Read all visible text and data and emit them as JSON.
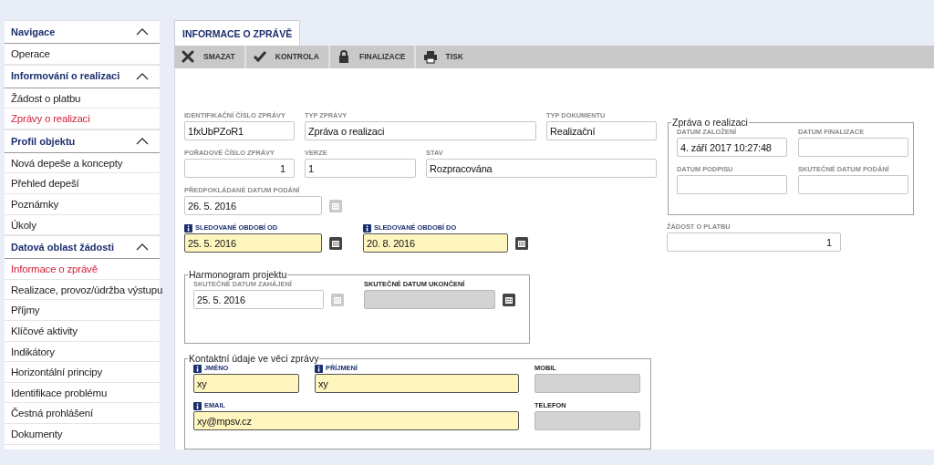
{
  "sidebar": {
    "sections": [
      {
        "title": "Navigace",
        "expanded": true,
        "items": [
          {
            "label": "Operace",
            "selected": false
          }
        ]
      },
      {
        "title": "Informování o realizaci",
        "expanded": true,
        "items": [
          {
            "label": "Žádost o platbu",
            "selected": false
          },
          {
            "label": "Zprávy o realizaci",
            "selected": true
          }
        ]
      },
      {
        "title": "Profil objektu",
        "expanded": true,
        "items": [
          {
            "label": "Nová depeše a koncepty",
            "selected": false
          },
          {
            "label": "Přehled depeší",
            "selected": false
          },
          {
            "label": "Poznámky",
            "selected": false
          },
          {
            "label": "Úkoly",
            "selected": false
          }
        ]
      },
      {
        "title": "Datová oblast žádosti",
        "expanded": true,
        "items": [
          {
            "label": "Informace o zprávě",
            "selected": true
          },
          {
            "label": "Realizace, provoz/údržba výstupu",
            "selected": false
          },
          {
            "label": "Příjmy",
            "selected": false
          },
          {
            "label": "Klíčové aktivity",
            "selected": false
          },
          {
            "label": "Indikátory",
            "selected": false
          },
          {
            "label": "Horizontální principy",
            "selected": false
          },
          {
            "label": "Identifikace problému",
            "selected": false
          },
          {
            "label": "Čestná prohlášení",
            "selected": false
          },
          {
            "label": "Dokumenty",
            "selected": false
          }
        ]
      }
    ]
  },
  "tabs": [
    {
      "label": "INFORMACE O ZPRÁVĚ",
      "selected": true
    }
  ],
  "toolbar": [
    "SMAZAT",
    "KONTROLA",
    "FINALIZACE",
    "TISK"
  ],
  "form": {
    "fields": [
      {
        "label": "IDENTIFIKAČNÍ ČÍSLO ZPRÁVY",
        "value": "1fxUbPZoR1",
        "kind": "readonly"
      },
      {
        "label": "TYP ZPRÁVY",
        "value": "Zpráva o realizaci",
        "kind": "readonly"
      },
      {
        "label": "TYP DOKUMENTU",
        "value": "Realizační",
        "kind": "readonly"
      },
      {
        "label": "POŘADOVÉ ČÍSLO ZPRÁVY",
        "value": "1",
        "kind": "readonly"
      },
      {
        "label": "VERZE",
        "value": "1",
        "kind": "readonly"
      },
      {
        "label": "STAV",
        "value": "Rozpracována",
        "kind": "readonly"
      },
      {
        "label": "PŘEDPOKLÁDANÉ DATUM PODÁNÍ",
        "value": "26. 5. 2016",
        "kind": "readonly",
        "calendar_disabled": true
      },
      {
        "label": "SLEDOVANÉ OBDOBÍ OD",
        "value": "25. 5. 2016",
        "kind": "required",
        "calendar_disabled": false
      },
      {
        "label": "SLEDOVANÉ OBDOBÍ DO",
        "value": "20. 8. 2016",
        "kind": "required",
        "calendar_disabled": false
      }
    ],
    "harmonogram": {
      "title": "Harmonogram projektu",
      "fields": [
        {
          "label": "SKUTEČNÉ DATUM ZAHÁJENÍ",
          "value": "25. 5. 2016",
          "kind": "readonly",
          "calendar_disabled": true
        },
        {
          "label": "SKUTEČNÉ DATUM UKONČENÍ",
          "kind": "disabled",
          "calendar_disabled": false
        }
      ]
    },
    "contact": {
      "title": "Kontaktní údaje ve věci zprávy",
      "fields": [
        {
          "label": "JMÉNO",
          "value": "xy",
          "kind": "required"
        },
        {
          "label": "PŘÍJMENÍ",
          "value": "xy",
          "kind": "required"
        },
        {
          "label": "MOBIL",
          "kind": "disabled"
        },
        {
          "label": "EMAIL",
          "value": "xy@mpsv.cz",
          "kind": "required"
        },
        {
          "label": "TELEFON",
          "kind": "disabled"
        }
      ]
    }
  },
  "report": {
    "title": "Zpráva o realizaci",
    "fields": [
      {
        "label": "DATUM ZALOŽENÍ",
        "value": "4. září 2017 10:27:48",
        "kind": "readonly"
      },
      {
        "label": "DATUM FINALIZACE",
        "kind": "readonly"
      },
      {
        "label": "DATUM PODPISU",
        "kind": "readonly"
      },
      {
        "label": "SKUTEČNÉ DATUM PODÁNÍ",
        "kind": "readonly"
      }
    ]
  },
  "payment_request": {
    "label": "ŽÁDOST O PLATBU",
    "value": "1",
    "kind": "readonly"
  }
}
